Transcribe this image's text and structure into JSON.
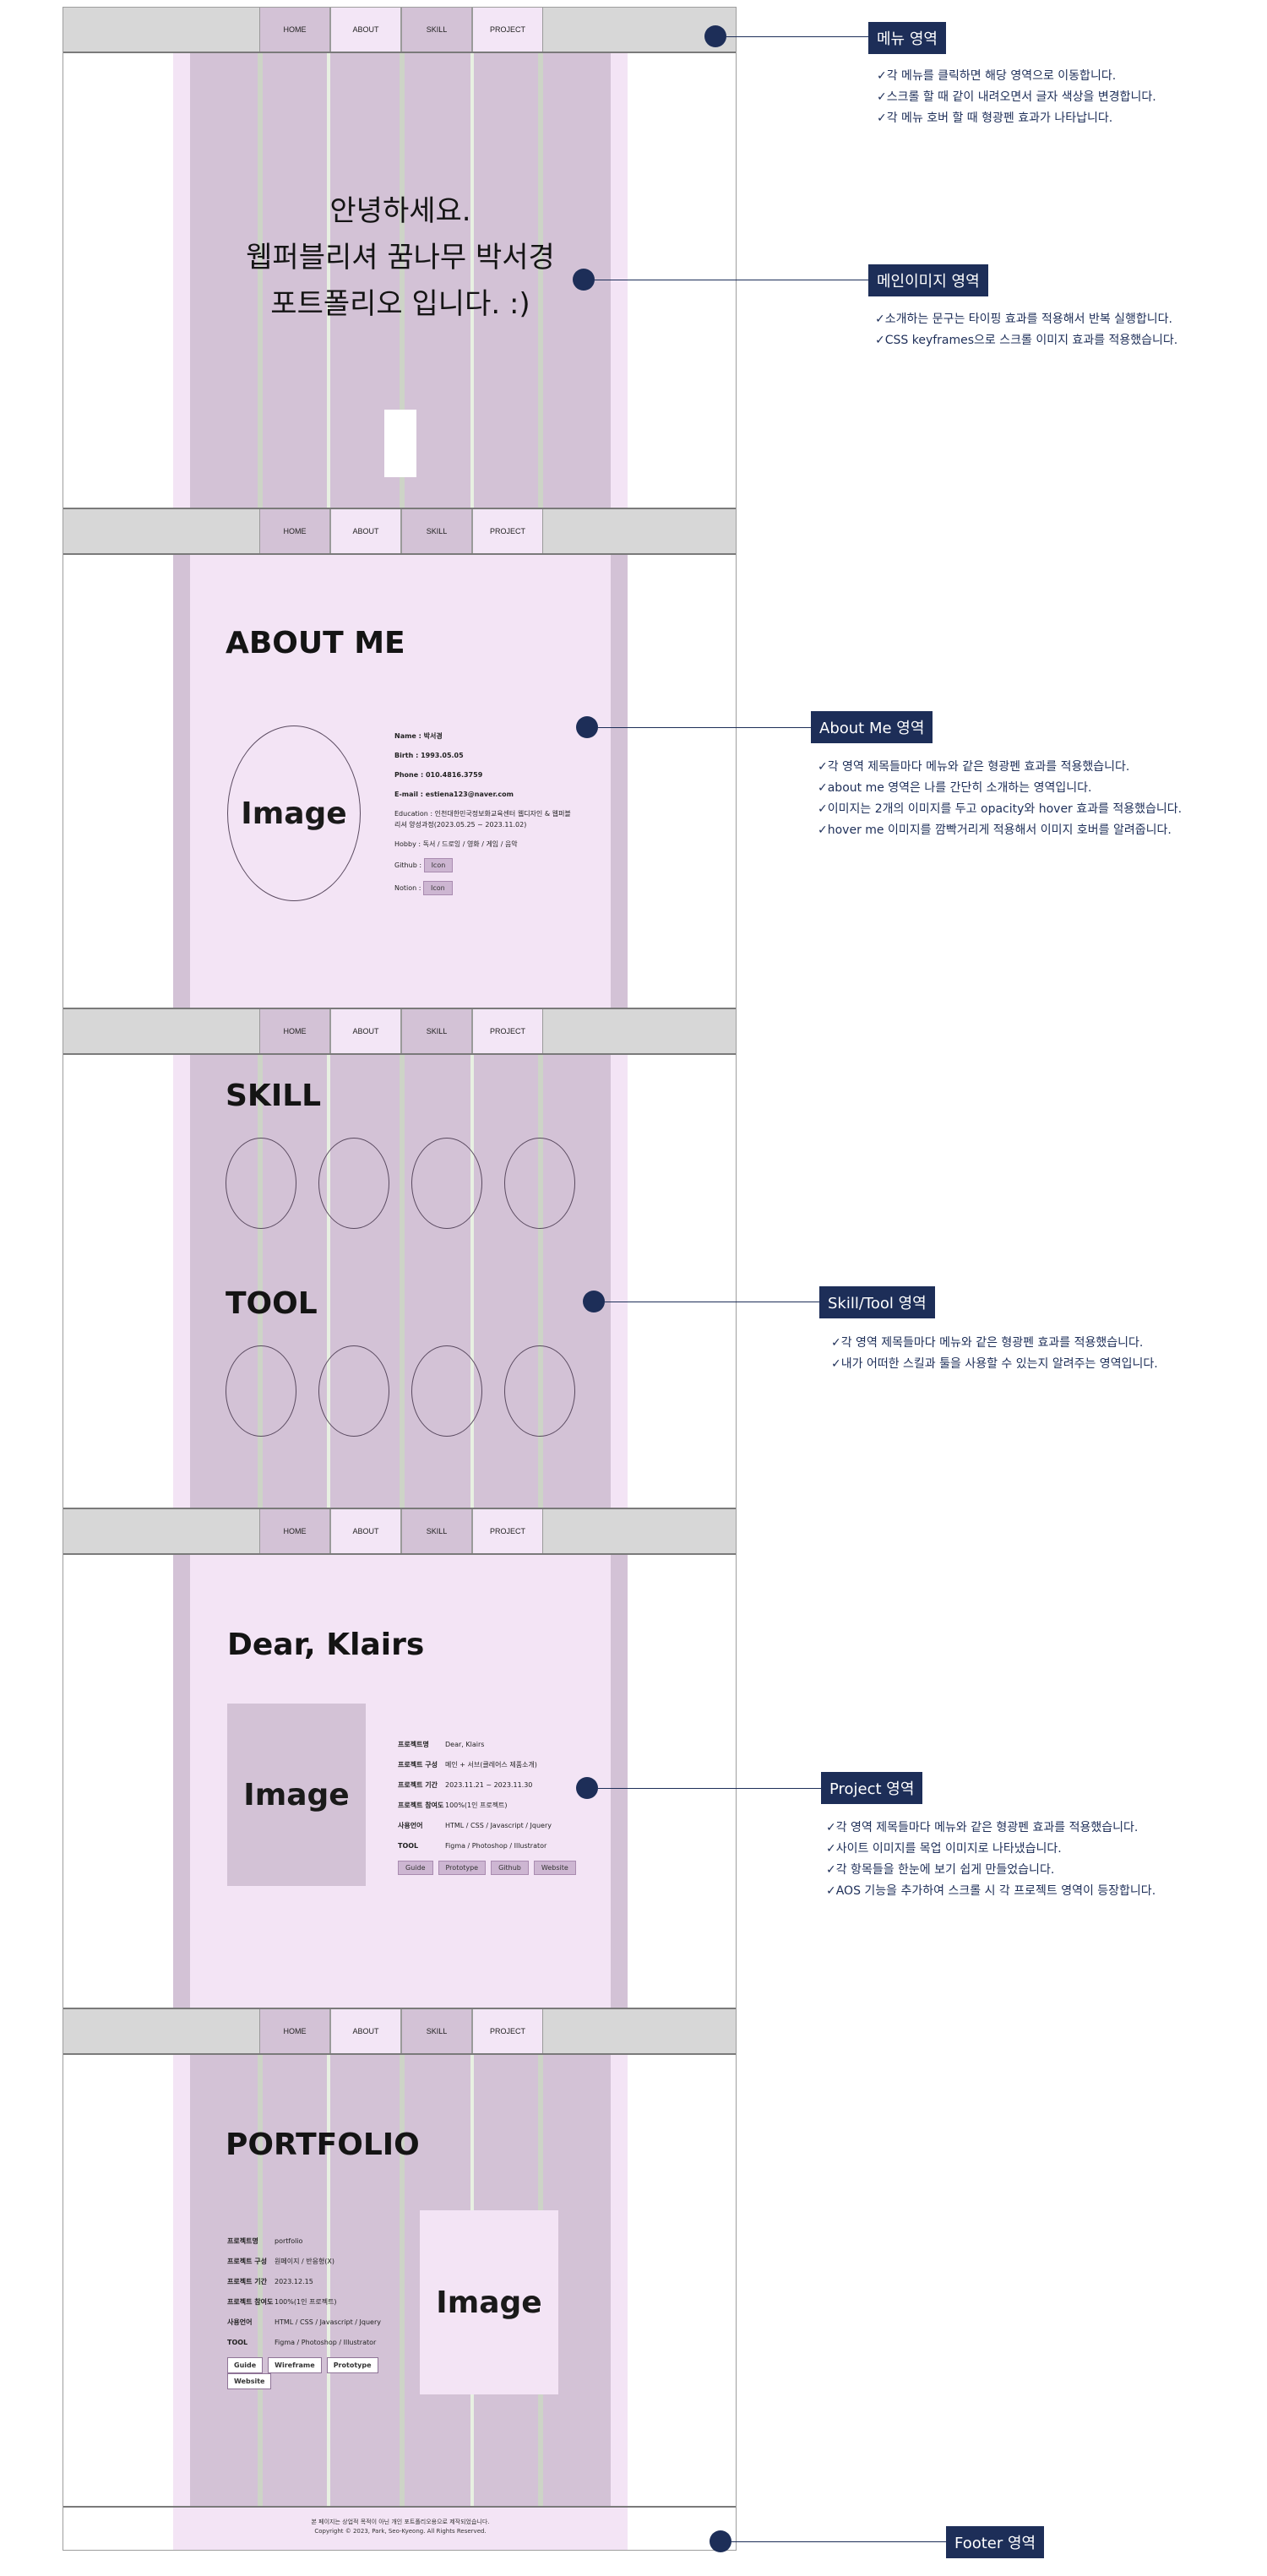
{
  "nav": {
    "items": [
      "HOME",
      "ABOUT",
      "SKILL",
      "PROJECT"
    ]
  },
  "hero": {
    "lines": [
      "안녕하세요.",
      "웹퍼블리셔 꿈나무 박서경",
      "포트폴리오 입니다. :)"
    ]
  },
  "about": {
    "title": "ABOUT ME",
    "image_label": "Image",
    "rows": [
      "Name : 박서경",
      "Birth : 1993.05.05",
      "Phone : 010.4816.3759",
      "E-mail : estiena123@naver.com",
      "Education : 인천대한민국정보화교육센터 웹디자인 & 웹퍼블리셔 양성과정(2023.05.25 ~ 2023.11.02)",
      "Hobby : 독서 / 드로잉 / 영화 / 게임 / 음악",
      "Github : ",
      "Notion : "
    ],
    "github_tag": "Icon",
    "notion_tag": "Icon"
  },
  "skill": {
    "skill_title": "SKILL",
    "tool_title": "TOOL"
  },
  "project": {
    "title": "Dear, Klairs",
    "image_label": "Image",
    "rows": [
      {
        "label": "프로젝트명",
        "value": "Dear, Klairs"
      },
      {
        "label": "프로젝트 구성",
        "value": "메인 + 서브(클레어스 제품소개)"
      },
      {
        "label": "프로젝트 기간",
        "value": "2023.11.21 ~ 2023.11.30"
      },
      {
        "label": "프로젝트 참여도",
        "value": "100%(1인 프로젝트)"
      },
      {
        "label": "사용언어",
        "value": "HTML / CSS / Javascript / Jquery"
      },
      {
        "label": "TOOL",
        "value": "Figma / Photoshop / Illustrator"
      }
    ],
    "buttons": [
      "Guide",
      "Prototype",
      "Github",
      "Website"
    ]
  },
  "portfolio": {
    "title": "PORTFOLIO",
    "image_label": "Image",
    "rows": [
      {
        "label": "프로젝트명",
        "value": "portfolio"
      },
      {
        "label": "프로젝트 구성",
        "value": "원페이지 / 반응형(X)"
      },
      {
        "label": "프로젝트 기간",
        "value": "2023.12.15"
      },
      {
        "label": "프로젝트 참여도",
        "value": "100%(1인 프로젝트)"
      },
      {
        "label": "사용언어",
        "value": "HTML / CSS / Javascript / Jquery"
      },
      {
        "label": "TOOL",
        "value": "Figma / Photoshop / Illustrator"
      }
    ],
    "buttons": [
      "Guide",
      "Wireframe",
      "Prototype",
      "Website"
    ]
  },
  "footer": {
    "line1": "본 페이지는 상업적 목적이 아닌 개인 포트폴리오용으로 제작되었습니다.",
    "line2": "Copyright © 2023, Park, Seo-Kyeong. All Rights Reserved."
  },
  "callouts": [
    {
      "label": "메뉴 영역",
      "notes": [
        "✓각 메뉴를 클릭하면 해당 영역으로 이동합니다.",
        "✓스크롤 할 때 같이 내려오면서 글자 색상을 변경합니다.",
        "✓각 메뉴 호버 할 때 형광펜 효과가 나타납니다."
      ]
    },
    {
      "label": "메인이미지 영역",
      "notes": [
        "✓소개하는 문구는 타이핑 효과를 적용해서 반복 실행합니다.",
        "✓CSS keyframes으로 스크롤 이미지 효과를 적용했습니다."
      ]
    },
    {
      "label": "About Me 영역",
      "notes": [
        "✓각 영역 제목들마다 메뉴와 같은 형광펜 효과를 적용했습니다.",
        "✓about me 영역은 나를 간단히 소개하는 영역입니다.",
        "✓이미지는 2개의 이미지를 두고 opacity와 hover 효과를 적용했습니다.",
        "✓hover me 이미지를 깜빡거리게 적용해서 이미지 호버를 알려줍니다."
      ]
    },
    {
      "label": "Skill/Tool 영역",
      "notes": [
        "✓각 영역 제목들마다 메뉴와 같은 형광펜 효과를 적용했습니다.",
        "✓내가 어떠한 스킬과 툴을 사용할 수 있는지 알려주는 영역입니다."
      ]
    },
    {
      "label": "Project 영역",
      "notes": [
        "✓각 영역 제목들마다 메뉴와 같은 형광펜 효과를 적용했습니다.",
        "✓사이트 이미지를 목업 이미지로 나타냈습니다.",
        "✓각 항목들을 한눈에 보기 쉽게 만들었습니다.",
        "✓AOS 기능을 추가하여 스크롤 시 각 프로젝트 영역이 등장합니다."
      ]
    },
    {
      "label": "Footer 영역",
      "notes": []
    }
  ]
}
